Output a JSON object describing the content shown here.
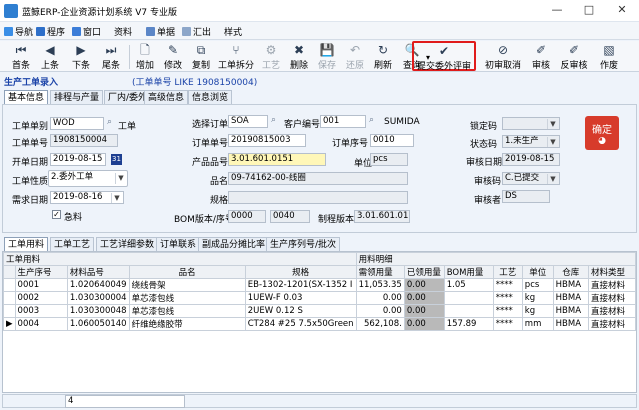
{
  "window": {
    "title": "蓝鲸ERP-企业资源计划系统 V7 专业版",
    "minimize": "—",
    "maximize": "□",
    "close": "✕"
  },
  "menubar": {
    "items": [
      {
        "label": "导航",
        "icon": "navigation-icon",
        "color": "#3a8ee6"
      },
      {
        "label": "程序",
        "icon": "program-icon",
        "color": "#2e6fc9"
      },
      {
        "label": "窗口",
        "icon": "window-icon",
        "color": "#3b7dd8"
      },
      {
        "label": "资料",
        "icon": "",
        "color": ""
      },
      {
        "label": "单据",
        "icon": "document-icon",
        "color": "#5b86c7"
      },
      {
        "label": "汇出",
        "icon": "export-icon",
        "color": "#8ca6c9"
      },
      {
        "label": "样式",
        "icon": "",
        "color": ""
      }
    ]
  },
  "toolbar": {
    "buttons": [
      {
        "label": "首条",
        "glyph": "⏮",
        "name": "first-record-button",
        "disabled": false
      },
      {
        "label": "上条",
        "glyph": "◀",
        "name": "prev-record-button",
        "disabled": false
      },
      {
        "label": "下条",
        "glyph": "▶",
        "name": "next-record-button",
        "disabled": false
      },
      {
        "label": "尾条",
        "glyph": "⏭",
        "name": "last-record-button",
        "disabled": false
      },
      {
        "label": "增加",
        "glyph": "🗋",
        "name": "add-button",
        "disabled": false
      },
      {
        "label": "修改",
        "glyph": "✎",
        "name": "edit-button",
        "disabled": false
      },
      {
        "label": "复制",
        "glyph": "⧉",
        "name": "copy-button",
        "disabled": false
      },
      {
        "label": "工单拆分",
        "glyph": "⑂",
        "name": "split-order-button",
        "disabled": false
      },
      {
        "label": "工艺",
        "glyph": "⚙",
        "name": "process-button",
        "disabled": true
      },
      {
        "label": "删除",
        "glyph": "✖",
        "name": "delete-button",
        "disabled": false
      },
      {
        "label": "保存",
        "glyph": "💾",
        "name": "save-button",
        "disabled": true
      },
      {
        "label": "还原",
        "glyph": "↶",
        "name": "undo-button",
        "disabled": true
      },
      {
        "label": "刷新",
        "glyph": "↻",
        "name": "refresh-button",
        "disabled": false
      },
      {
        "label": "查询",
        "glyph": "🔍",
        "name": "query-button",
        "disabled": false
      },
      {
        "label": "提交委外评审",
        "glyph": "✔",
        "name": "submit-outsource-review-button",
        "disabled": false
      },
      {
        "label": "初审取消",
        "glyph": "⊘",
        "name": "cancel-first-review-button",
        "disabled": false
      },
      {
        "label": "审核",
        "glyph": "✐",
        "name": "approve-button",
        "disabled": false
      },
      {
        "label": "反审核",
        "glyph": "✐",
        "name": "unapprove-button",
        "disabled": false
      },
      {
        "label": "作废",
        "glyph": "▧",
        "name": "void-button",
        "disabled": false
      }
    ],
    "query_arrow": "▾"
  },
  "page": {
    "title": "生产工单录入",
    "filter": "(工单单号 LIKE 1908150004)"
  },
  "top_tabs": [
    "基本信息",
    "排程与产量",
    "厂内/委外",
    "高级信息",
    "信息浏览"
  ],
  "form": {
    "wo_type_label": "工单单别",
    "wo_type_value": "WOD",
    "wo_type_name": "工单",
    "wo_no_label": "工单单号",
    "wo_no_value": "1908150004",
    "open_date_label": "开单日期",
    "open_date_value": "2019-08-15",
    "wo_nature_label": "工单性质",
    "wo_nature_value": "2.委外工单",
    "need_date_label": "需求日期",
    "need_date_value": "2019-08-16",
    "urgent_label": "急料",
    "sel_order_label": "选择订单",
    "sel_order_value": "SOA",
    "order_no_label": "订单单号",
    "order_no_value": "20190815003",
    "product_no_label": "产品品号",
    "product_no_value": "3.01.601.0151",
    "name_label": "品名",
    "name_value": "09-74162-00-线圈",
    "spec_label": "规格",
    "spec_value": "",
    "bom_label": "BOM版本/序号",
    "bom_value1": "0000",
    "bom_value2": "0040",
    "cust_no_label": "客户编号",
    "cust_no_value": "001",
    "cust_name": "SUMIDA",
    "order_seq_label": "订单序号",
    "order_seq_value": "0010",
    "unit_label": "单位",
    "unit_value": "pcs",
    "make_ver_label": "制程版本",
    "make_ver_value": "3.01.601.0151",
    "lock_label": "锁定码",
    "lock_value": "",
    "status_label": "状态码",
    "status_value": "1.未生产",
    "audit_date_label": "审核日期",
    "audit_date_value": "2019-08-15",
    "audit_code_label": "审核码",
    "audit_code_value": "C.已提交",
    "auditor_label": "审核者",
    "auditor_value": "DS",
    "confirm_label": "确定",
    "calendar_glyph": "31",
    "checkmark": "✓"
  },
  "bottom_tabs": [
    "工单用料",
    "工单工艺",
    "工艺详细参数",
    "订单联系",
    "副成品分摊比率",
    "生产序列号/批次"
  ],
  "grid": {
    "group1": "工单用料",
    "group2": "用料明细",
    "columns": [
      "生产序号",
      "材料品号",
      "品名",
      "规格",
      "需领用量",
      "已领用量",
      "BOM用量",
      "工艺",
      "单位",
      "仓库",
      "材料类型"
    ],
    "rows": [
      {
        "marker": "",
        "cells": [
          "0001",
          "1.020640049",
          "绕线骨架",
          "EB-1302-1201(SX-1352 I",
          "11,053.35",
          "0.00",
          "1.05",
          "****",
          "pcs",
          "HBMA",
          "直接材料"
        ]
      },
      {
        "marker": "",
        "cells": [
          "0002",
          "1.030300004",
          "单芯漆包线",
          "1UEW-F 0.03",
          "0.00",
          "0.00",
          "",
          "****",
          "kg",
          "HBMA",
          "直接材料"
        ]
      },
      {
        "marker": "",
        "cells": [
          "0003",
          "1.030300048",
          "单芯漆包线",
          "2UEW 0.12 S",
          "0.00",
          "0.00",
          "",
          "****",
          "kg",
          "HBMA",
          "直接材料"
        ]
      },
      {
        "marker": "▶",
        "cells": [
          "0004",
          "1.060050140",
          "纤维绝缘胶带",
          "CT284 #25 7.5x50Green",
          "562,108.",
          "0.00",
          "157.89",
          "****",
          "mm",
          "HBMA",
          "直接材料"
        ]
      }
    ],
    "footer_count": "4"
  }
}
